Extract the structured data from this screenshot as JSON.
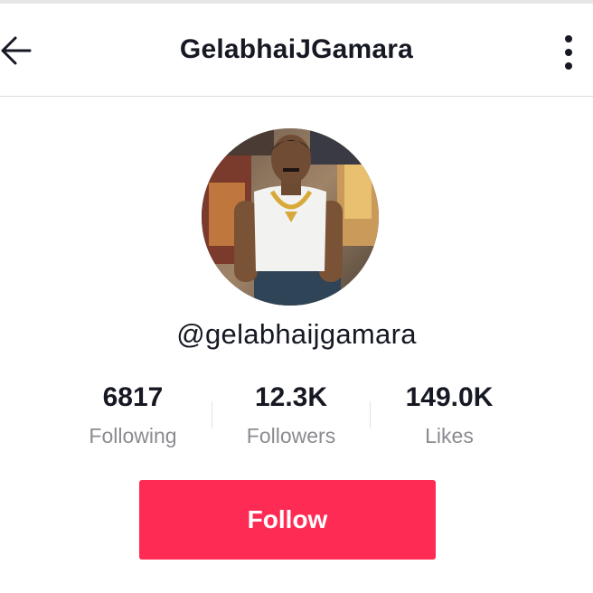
{
  "header": {
    "title": "GelabhaiJGamara",
    "back_icon": "arrow-left-icon",
    "more_icon": "more-vertical-icon"
  },
  "profile": {
    "avatar": "profile-photo",
    "username": "@gelabhaijgamara"
  },
  "stats": [
    {
      "value": "6817",
      "label": "Following"
    },
    {
      "value": "12.3K",
      "label": "Followers"
    },
    {
      "value": "149.0K",
      "label": "Likes"
    }
  ],
  "actions": {
    "follow_label": "Follow"
  },
  "colors": {
    "accent": "#fe2c55",
    "text_primary": "#161823",
    "text_secondary": "#8a8b91",
    "divider": "#dcdcdc"
  }
}
